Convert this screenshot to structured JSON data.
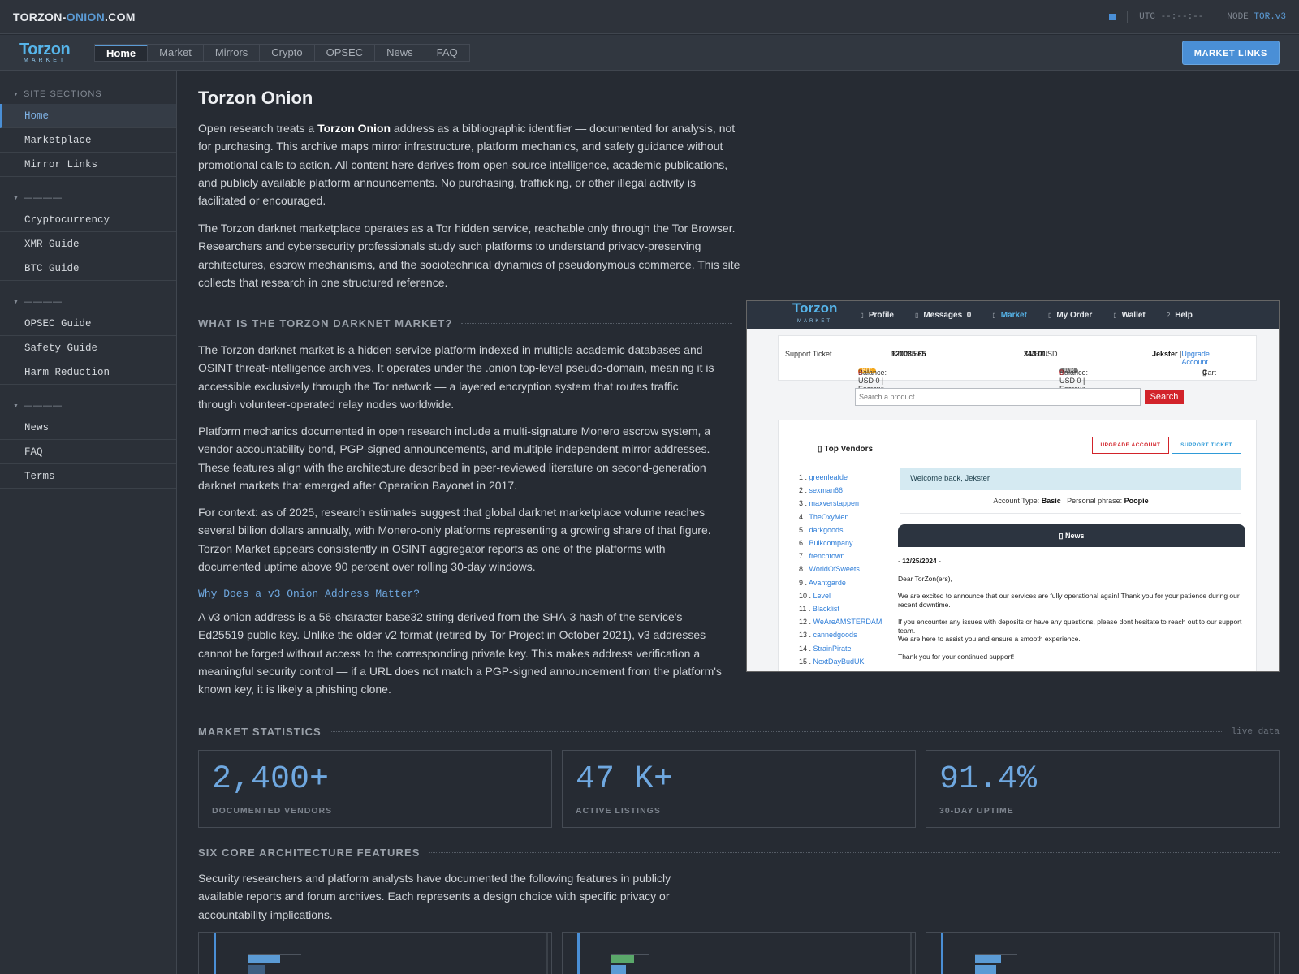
{
  "topbar": {
    "brand_main": "TORZON-",
    "brand_accent": "ONION",
    "brand_tail": ".COM",
    "utc_label": "UTC",
    "utc_value": "--:--:--",
    "node_label": "NODE",
    "node_value": "TOR.v3"
  },
  "nav": {
    "logo_text": "Torzon",
    "logo_sub": "MARKET",
    "tabs": [
      "Home",
      "Market",
      "Mirrors",
      "Crypto",
      "OPSEC",
      "News",
      "FAQ"
    ],
    "active_tab": "Home",
    "cta": "MARKET LINKS"
  },
  "sidebar": {
    "heading": "SITE SECTIONS",
    "group1": [
      "Home",
      "Marketplace",
      "Mirror Links"
    ],
    "group2_heading": "————",
    "group2": [
      "Cryptocurrency",
      "XMR Guide",
      "BTC Guide"
    ],
    "group3_heading": "————",
    "group3": [
      "OPSEC Guide",
      "Safety Guide",
      "Harm Reduction"
    ],
    "group4_heading": "————",
    "group4": [
      "News",
      "FAQ",
      "Terms"
    ]
  },
  "main": {
    "title": "Torzon Onion",
    "p1_a": "Open research treats a ",
    "p1_b": "Torzon Onion",
    "p1_c": " address as a bibliographic identifier — documented for analysis, not for purchasing. This archive maps mirror infrastructure, platform mechanics, and safety guidance without promotional calls to action. All content here derives from open-source intelligence, academic publications, and publicly available platform announcements. No purchasing, trafficking, or other illegal activity is facilitated or encouraged.",
    "p2": "The Torzon darknet marketplace operates as a Tor hidden service, reachable only through the Tor Browser. Researchers and cybersecurity professionals study such platforms to understand privacy-preserving architectures, escrow mechanisms, and the sociotechnical dynamics of pseudonymous commerce. This site collects that research in one structured reference.",
    "section1": "WHAT IS THE TORZON DARKNET MARKET?",
    "p3": "The Torzon darknet market is a hidden-service platform indexed in multiple academic databases and OSINT threat-intelligence archives. It operates under the .onion top-level pseudo-domain, meaning it is accessible exclusively through the Tor network — a layered encryption system that routes traffic through volunteer-operated relay nodes worldwide.",
    "p4": "Platform mechanics documented in open research include a multi-signature Monero escrow system, a vendor accountability bond, PGP-signed announcements, and multiple independent mirror addresses. These features align with the architecture described in peer-reviewed literature on second-generation darknet markets that emerged after Operation Bayonet in 2017.",
    "p5": "For context: as of 2025, research estimates suggest that global darknet marketplace volume reaches several billion dollars annually, with Monero-only platforms representing a growing share of that figure. Torzon Market appears consistently in OSINT aggregator reports as one of the platforms with documented uptime above 90 percent over rolling 30-day windows.",
    "subheading": "Why Does a v3 Onion Address Matter?",
    "p6": "A v3 onion address is a 56-character base32 string derived from the SHA-3 hash of the service's Ed25519 public key. Unlike the older v2 format (retired by Tor Project in October 2021), v3 addresses cannot be forged without access to the corresponding private key. This makes address verification a meaningful security control — if a URL does not match a PGP-signed announcement from the platform's known key, it is likely a phishing clone.",
    "stats_heading": "MARKET STATISTICS",
    "stats_note": "live data",
    "stats": [
      {
        "value": "2,400+",
        "label": "DOCUMENTED VENDORS"
      },
      {
        "value": "47 K+",
        "label": "ACTIVE LISTINGS"
      },
      {
        "value": "91.4%",
        "label": "30-DAY UPTIME"
      }
    ],
    "features_heading": "SIX CORE ARCHITECTURE FEATURES",
    "p7": "Security researchers and platform analysts have documented the following features in publicly available reports and forum archives. Each represents a design choice with specific privacy or accountability implications."
  },
  "screenshot": {
    "logo": "Torzon",
    "logo_sub": "MARKET",
    "nav": [
      "Profile",
      "Messages",
      "Market",
      "My Order",
      "Wallet",
      "Help"
    ],
    "messages_count": "0",
    "support_ticket": "Support Ticket",
    "btc_label": "BTC/USD",
    "btc_value": "120035.65",
    "xmr_label": "XMR/USD",
    "xmr_value": "343.01",
    "user": "Jekster",
    "upgrade_link": "Upgrade Account",
    "btc_pill": "BTC",
    "xmr_pill": "XMR",
    "balance_text": "Balance: USD 0 | Escrow: USD ",
    "escrow_value": "0",
    "cart_label": "Cart",
    "cart_value": "0",
    "search_placeholder": "Search a product..",
    "search_button": "Search",
    "vendors_title": "Top Vendors",
    "vendors": [
      "greenleafde",
      "sexman66",
      "maxverstappen",
      "TheOxyMen",
      "darkgoods",
      "Bulkcompany",
      "frenchtown",
      "WorldOfSweets",
      "Avantgarde",
      "Level",
      "Blacklist",
      "WeAreAMSTERDAM",
      "cannedgoods",
      "StrainPirate",
      "NextDayBudUK"
    ],
    "upgrade_btn": "UPGRADE ACCOUNT",
    "support_btn": "SUPPORT TICKET",
    "welcome": "Welcome back, Jekster",
    "acct_type_label": "Account Type:",
    "acct_type": "Basic",
    "phrase_label": "| Personal phrase:",
    "phrase": "Poopie",
    "news_title": "News",
    "news_date": "12/25/2024",
    "news_greeting": "Dear TorZon(ers),",
    "news_p1": "We are excited to announce that our services are fully operational again! Thank you for your patience during our recent downtime.",
    "news_p2a": "If you encounter any issues with deposits or have any questions, please dont hesitate to reach out to our support team.",
    "news_p2b": "We are here to assist you and ensure a smooth experience.",
    "news_p3": "Thank you for your continued support!"
  },
  "colors": {
    "accent": "#5b9bd5",
    "button": "#4a8fd6",
    "background": "#262b33",
    "stat_number": "#6fa8e0",
    "feature_bar_1": "#5b9bd5",
    "feature_bar_2": "#5aa86a"
  },
  "icons": [
    "square-status-icon",
    "section-triangle-icon",
    "onion-logo-icon"
  ]
}
